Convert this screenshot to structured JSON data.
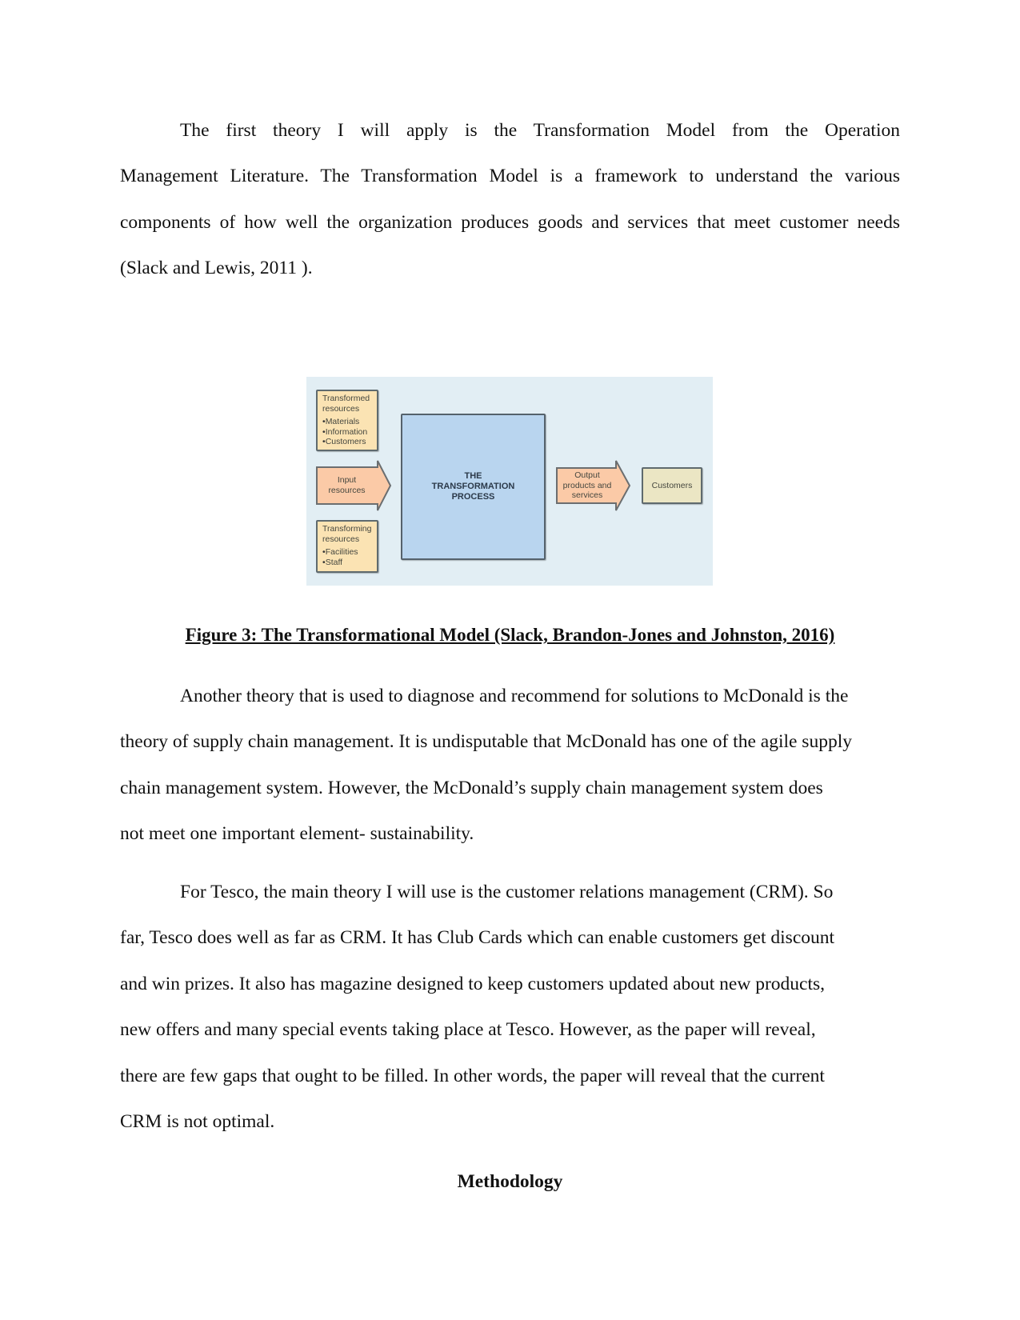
{
  "paragraphs": [
    {
      "lines": [
        "The first theory I will apply is the Transformation Model from the Operation",
        "Management Literature. The Transformation Model is a framework to understand the various",
        "components of how well the organization produces goods and services that meet customer needs",
        "(Slack and Lewis, 2011 )."
      ]
    },
    {
      "lines": [
        "Another theory that is used to diagnose and recommend for solutions to McDonald is the",
        "theory of supply chain management. It is undisputable that McDonald has one of the agile supply",
        "chain management system. However, the McDonald’s supply chain management system does",
        "not meet one important element- sustainability."
      ]
    },
    {
      "lines": [
        "For Tesco, the main theory I will use is the customer relations management (CRM). So",
        "far, Tesco does well as far as CRM. It has Club Cards which can enable customers get discount",
        "and win prizes. It also has magazine designed to keep customers updated about new products,",
        "new offers and many special events taking place at Tesco. However, as the paper will reveal,",
        "there are few gaps that ought to be filled. In other words, the paper will reveal that the current",
        "CRM is not optimal."
      ]
    }
  ],
  "figure": {
    "transformed_resources": {
      "title_line1": "Transformed",
      "title_line2": "resources",
      "items": [
        "Materials",
        "Information",
        "Customers"
      ]
    },
    "input_resources": {
      "line1": "Input",
      "line2": "resources"
    },
    "process": {
      "line1": "THE",
      "line2": "TRANSFORMATION",
      "line3": "PROCESS"
    },
    "transforming_resources": {
      "title_line1": "Transforming",
      "title_line2": "resources",
      "items": [
        "Facilities",
        "Staff"
      ]
    },
    "output": {
      "line1": "Output",
      "line2": "products and",
      "line3": "services"
    },
    "customers": "Customers",
    "colors": {
      "background": "#e2eef4",
      "resource_box": "#fbe3b3",
      "arrow": "#fbcaa7",
      "process_box": "#b9d5ef",
      "customers_box": "#ebe6c4"
    }
  },
  "caption": "Figure 3: The Transformational Model (Slack, Brandon-Jones and Johnston, 2016)",
  "heading": "Methodology"
}
